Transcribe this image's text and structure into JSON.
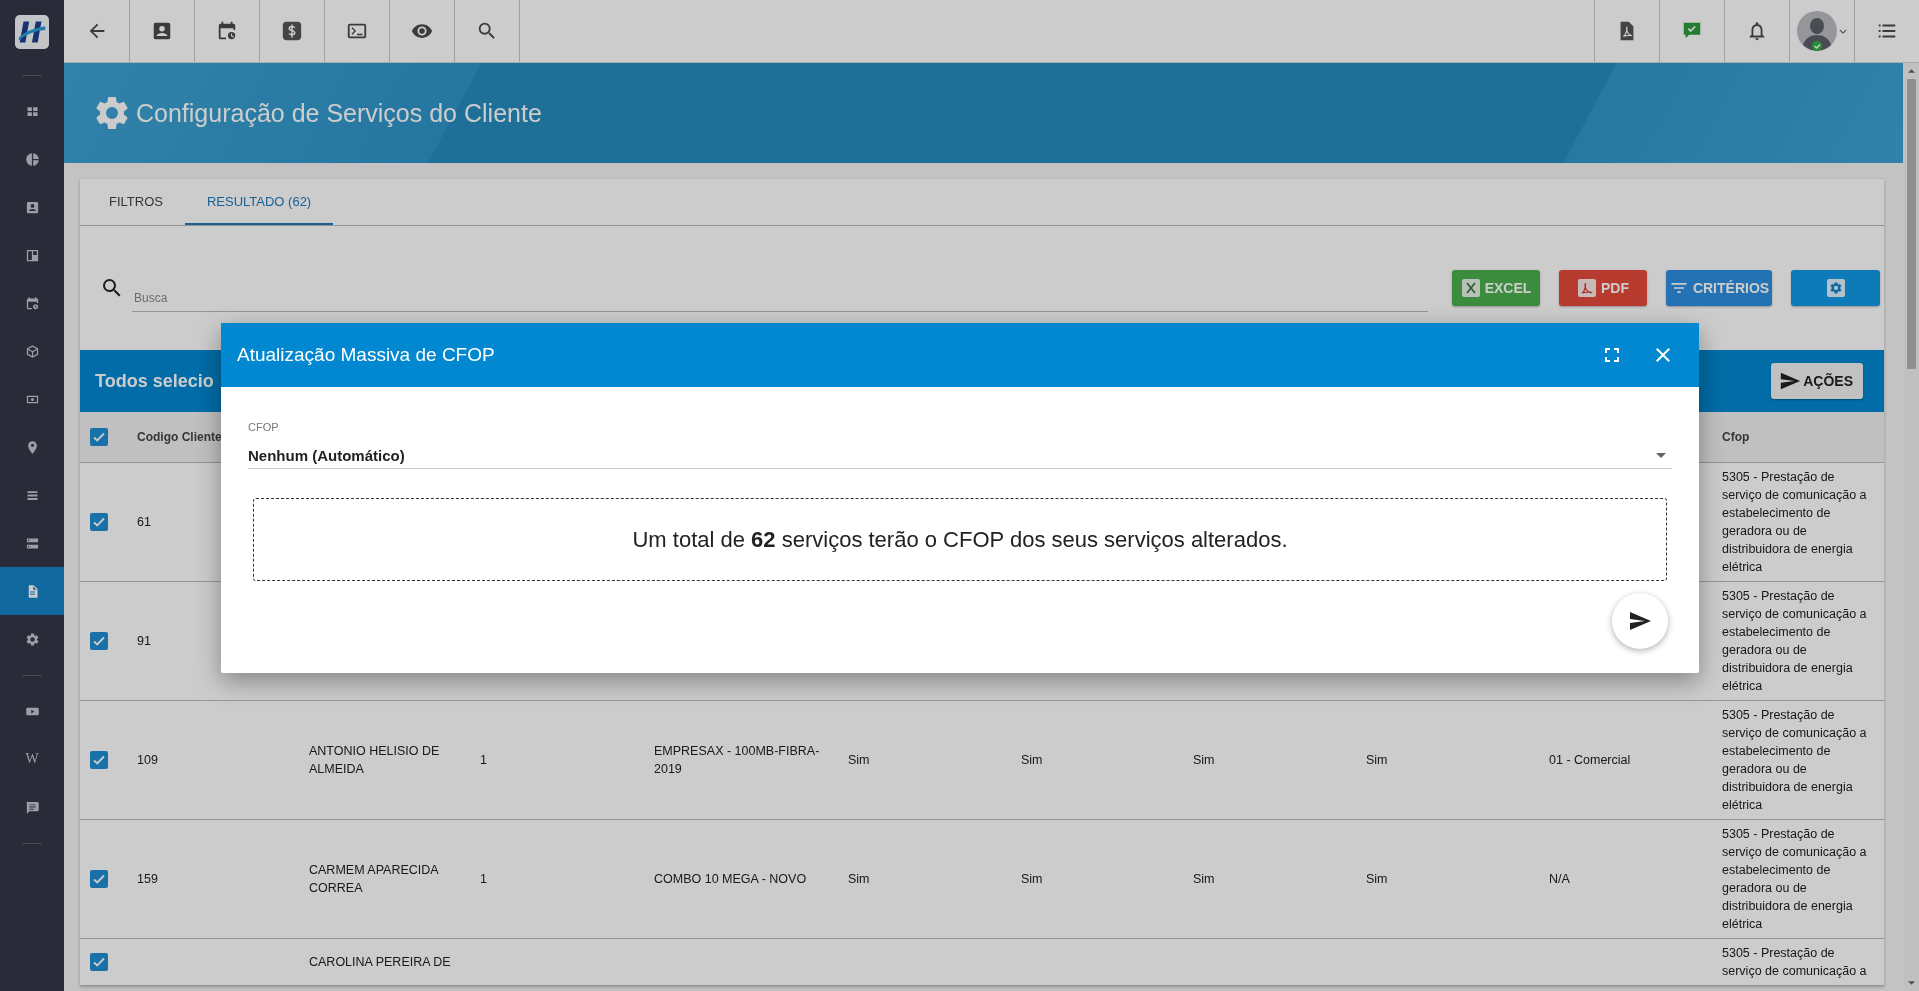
{
  "sidebar": {
    "groups": [
      {
        "items": [
          {
            "selected": false
          },
          {
            "selected": false
          },
          {
            "selected": false
          },
          {
            "selected": false
          },
          {
            "selected": false
          },
          {
            "selected": false
          },
          {
            "selected": false
          },
          {
            "selected": false
          },
          {
            "selected": false
          },
          {
            "selected": false
          },
          {
            "selected": true
          },
          {
            "selected": false
          }
        ]
      },
      {
        "items": [
          {
            "selected": false
          },
          {
            "selected": false,
            "glyph": "W"
          },
          {
            "selected": false
          }
        ]
      }
    ]
  },
  "page": {
    "title": "Configuração de Serviços do Cliente"
  },
  "tabs": [
    {
      "label": "FILTROS",
      "selected": false
    },
    {
      "label": "RESULTADO (62)",
      "selected": true
    }
  ],
  "search": {
    "placeholder": "Busca"
  },
  "buttons": [
    {
      "kind": "excel",
      "label": "EXCEL"
    },
    {
      "kind": "pdf",
      "label": "PDF"
    },
    {
      "kind": "criteria",
      "label": "CRITÉRIOS"
    },
    {
      "kind": "settings"
    }
  ],
  "selection_bar": {
    "title": "Todos selecio",
    "action": "AÇÕES"
  },
  "table": {
    "select_all": {
      "checked": true
    },
    "columns": {
      "code": "Codigo Cliente",
      "cfop": "Cfop"
    },
    "rows": [
      {
        "checked": true,
        "code": "61",
        "cfop": "5305 - Prestação de serviço de comunicação a estabelecimento de geradora ou de distribuidora de energia elétrica"
      },
      {
        "checked": true,
        "code": "91",
        "cfop": "5305 - Prestação de serviço de comunicação a estabelecimento de geradora ou de distribuidora de energia elétrica"
      },
      {
        "checked": true,
        "code": "109",
        "name": "ANTONIO HELISIO DE ALMEIDA",
        "quantity": "1",
        "service": "EMPRESAX - 100MB-FIBRA-2019",
        "flags": [
          "Sim",
          "Sim",
          "Sim",
          "Sim"
        ],
        "category": "01 - Comercial",
        "cfop": "5305 - Prestação de serviço de comunicação a estabelecimento de geradora ou de distribuidora de energia elétrica"
      },
      {
        "checked": true,
        "code": "159",
        "name": "CARMEM APARECIDA CORREA",
        "quantity": "1",
        "service": "COMBO 10 MEGA - NOVO",
        "flags": [
          "Sim",
          "Sim",
          "Sim",
          "Sim"
        ],
        "category": "N/A",
        "cfop": "5305 - Prestação de serviço de comunicação a estabelecimento de geradora ou de distribuidora de energia elétrica"
      },
      {
        "checked": true,
        "name": "CAROLINA PEREIRA DE",
        "cfop": "5305 - Prestação de serviço de comunicação a"
      }
    ]
  },
  "modal": {
    "title": "Atualização Massiva de CFOP",
    "field": {
      "label": "CFOP",
      "value": "Nenhum (Automático)"
    },
    "message": "Um total de **62** serviços terão o CFOP dos seus serviços alterados."
  }
}
